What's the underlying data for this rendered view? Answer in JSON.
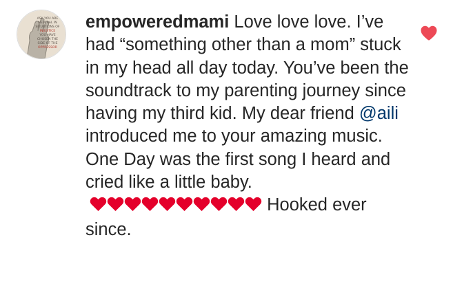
{
  "comment": {
    "username": "empoweredmami",
    "text_before_mention": "Love love love. I’ve had “something other than a mom” stuck in my head all day today. You’ve been the soundtrack to my parenting journey since having my third kid. My dear friend",
    "mention": "@aili",
    "text_after_mention": "introduced me to your amazing music. One Day was the first song I heard and cried like a little baby.",
    "hearts_count": 10,
    "text_after_hearts": "Hooked ever since.",
    "liked": true,
    "avatar_text_lines": [
      "ASK YOU ARE",
      "NEUTRAL IN",
      "SITUATIONS OF",
      "INJUSTICE",
      "YOU HAVE",
      "CHOSEN THE",
      "SIDE OF THE",
      "OPPRESSOR"
    ]
  },
  "icons": {
    "like": "heart-icon",
    "emoji": "red-heart-emoji"
  },
  "colors": {
    "text": "#262626",
    "mention": "#00376b",
    "like": "#ed4956",
    "emoji_heart": "#e4002b"
  }
}
